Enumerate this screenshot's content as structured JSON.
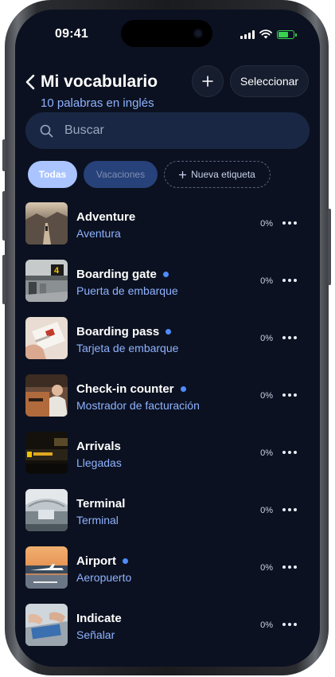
{
  "status_bar": {
    "time": "09:41",
    "battery_color": "#39d353"
  },
  "header": {
    "title": "Mi vocabulario",
    "subtitle": "10 palabras en inglés",
    "add_icon": "plus-icon",
    "select_label": "Seleccionar"
  },
  "search": {
    "placeholder": "Buscar",
    "value": ""
  },
  "filters": {
    "active": "Todas",
    "items": [
      "Todas",
      "Vacaciones"
    ],
    "new_tag_label": "Nueva etiqueta"
  },
  "words": [
    {
      "word": "Adventure",
      "translation": "Aventura",
      "progress": "0%",
      "new": false,
      "image": "landscape-photo"
    },
    {
      "word": "Boarding gate",
      "translation": "Puerta de embarque",
      "progress": "0%",
      "new": true,
      "image": "gate-photo"
    },
    {
      "word": "Boarding pass",
      "translation": "Tarjeta de embarque",
      "progress": "0%",
      "new": true,
      "image": "ticket-photo"
    },
    {
      "word": "Check-in counter",
      "translation": "Mostrador de facturación",
      "progress": "0%",
      "new": true,
      "image": "counter-photo"
    },
    {
      "word": "Arrivals",
      "translation": "Llegadas",
      "progress": "0%",
      "new": false,
      "image": "arrivals-board-photo"
    },
    {
      "word": "Terminal",
      "translation": "Terminal",
      "progress": "0%",
      "new": false,
      "image": "terminal-photo"
    },
    {
      "word": "Airport",
      "translation": "Aeropuerto",
      "progress": "0%",
      "new": true,
      "image": "airport-photo"
    },
    {
      "word": "Indicate",
      "translation": "Señalar",
      "progress": "0%",
      "new": false,
      "image": "hands-laptop-photo"
    }
  ],
  "colors": {
    "background": "#0b1120",
    "accent": "#8fb2ff",
    "new_dot": "#4f8cff",
    "chip_active": "#a9c4ff"
  }
}
